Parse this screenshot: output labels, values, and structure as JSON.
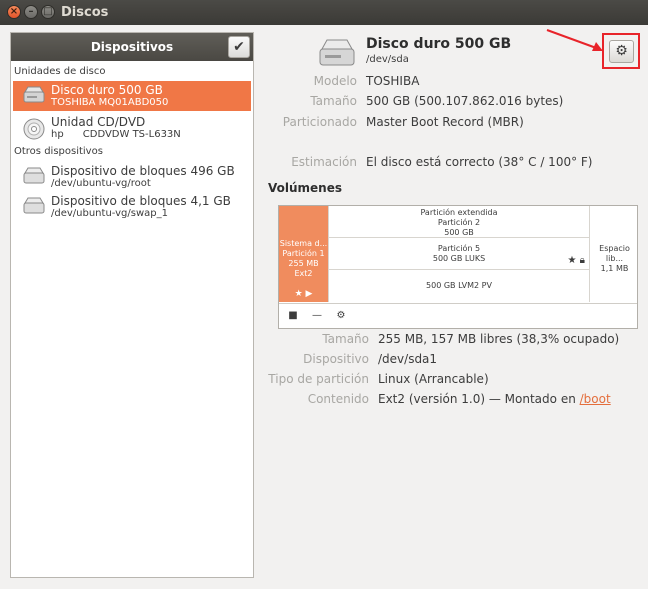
{
  "window": {
    "title": "Discos"
  },
  "sidebar": {
    "header": "Dispositivos",
    "section_disks": "Unidades de disco",
    "section_other": "Otros dispositivos",
    "devices": [
      {
        "name": "Disco duro 500 GB",
        "sub": "TOSHIBA MQ01ABD050",
        "icon": "hard-disk-icon"
      },
      {
        "name": "Unidad CD/DVD",
        "sub": "hp      CDDVDW TS-L633N",
        "icon": "optical-disc-icon"
      },
      {
        "name": "Dispositivo de bloques 496 GB",
        "sub": "/dev/ubuntu-vg/root",
        "icon": "block-device-icon"
      },
      {
        "name": "Dispositivo de bloques 4,1 GB",
        "sub": "/dev/ubuntu-vg/swap_1",
        "icon": "block-device-icon"
      }
    ],
    "selected_index": 0
  },
  "disk": {
    "title": "Disco duro 500 GB",
    "device": "/dev/sda",
    "props": [
      {
        "label": "Modelo",
        "value": "TOSHIBA"
      },
      {
        "label": "Tamaño",
        "value": "500 GB (500.107.862.016 bytes)"
      },
      {
        "label": "Particionado",
        "value": "Master Boot Record (MBR)"
      },
      {
        "label": "Estimación",
        "value": "El disco está correcto (38° C / 100° F)"
      }
    ]
  },
  "volumes": {
    "heading": "Volúmenes",
    "segments": {
      "selected": {
        "line1": "Sistema d...",
        "line2": "Partición 1",
        "line3": "255 MB Ext2"
      },
      "extended": {
        "line1": "Partición extendida",
        "line2": "Partición 2",
        "line3": "500 GB"
      },
      "luks": {
        "line1": "Partición 5",
        "line2": "500 GB LUKS"
      },
      "lvm": {
        "line1": "500 GB LVM2 PV"
      },
      "free": {
        "line1": "Espacio lib...",
        "line2": "1,1 MB"
      }
    },
    "selected_props": [
      {
        "label": "Tamaño",
        "value": "255 MB, 157 MB libres (38,3% ocupado)"
      },
      {
        "label": "Dispositivo",
        "value": "/dev/sda1"
      },
      {
        "label": "Tipo de partición",
        "value": "Linux (Arrancable)"
      },
      {
        "label": "Contenido",
        "value": "Ext2 (versión 1.0) — Montado en ",
        "link": "/boot"
      }
    ]
  },
  "colors": {
    "accent": "#f07746",
    "highlight_box": "#e8242a"
  }
}
